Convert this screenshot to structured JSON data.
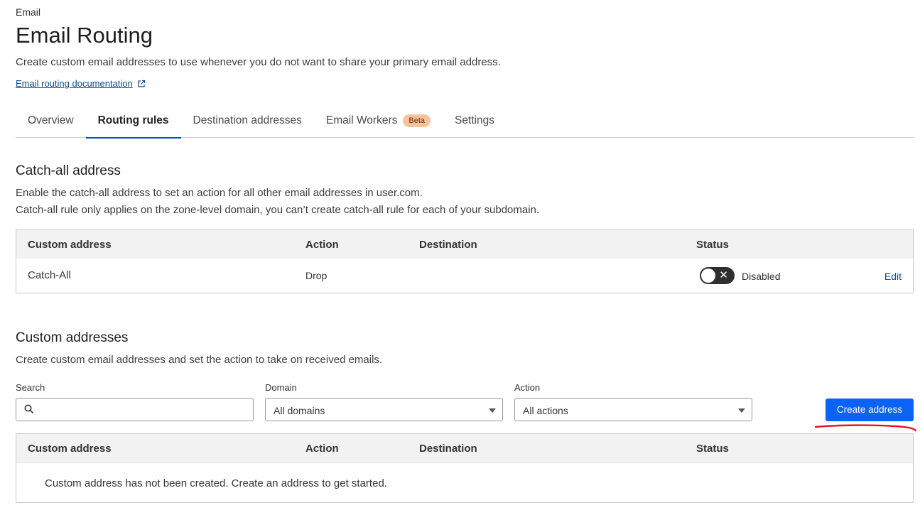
{
  "header": {
    "section": "Email",
    "title": "Email Routing",
    "description": "Create custom email addresses to use whenever you do not want to share your primary email address.",
    "doc_link": "Email routing documentation"
  },
  "tabs": [
    {
      "label": "Overview",
      "active": false
    },
    {
      "label": "Routing rules",
      "active": true
    },
    {
      "label": "Destination addresses",
      "active": false
    },
    {
      "label": "Email Workers",
      "active": false,
      "badge": "Beta"
    },
    {
      "label": "Settings",
      "active": false
    }
  ],
  "catch_all": {
    "heading": "Catch-all address",
    "desc1": "Enable the catch-all address to set an action for all other email addresses in user.com.",
    "desc2": "Catch-all rule only applies on the zone-level domain, you can’t create catch-all rule for each of your subdomain.",
    "columns": [
      "Custom address",
      "Action",
      "Destination",
      "Status"
    ],
    "row": {
      "address": "Catch-All",
      "action": "Drop",
      "destination": "",
      "status": "Disabled",
      "enabled": false,
      "edit_label": "Edit"
    }
  },
  "custom": {
    "heading": "Custom addresses",
    "desc": "Create custom email addresses and set the action to take on received emails.",
    "search_label": "Search",
    "search_value": "",
    "domain_label": "Domain",
    "domain_value": "All domains",
    "action_label": "Action",
    "action_value": "All actions",
    "create_button": "Create address",
    "columns": [
      "Custom address",
      "Action",
      "Destination",
      "Status"
    ],
    "empty_message": "Custom address has not been created. Create an address to get started."
  },
  "colors": {
    "accent": "#0051c3",
    "primary_button": "#0a63f6",
    "badge_bg": "#f8c39b",
    "annotation": "#e8141e"
  }
}
